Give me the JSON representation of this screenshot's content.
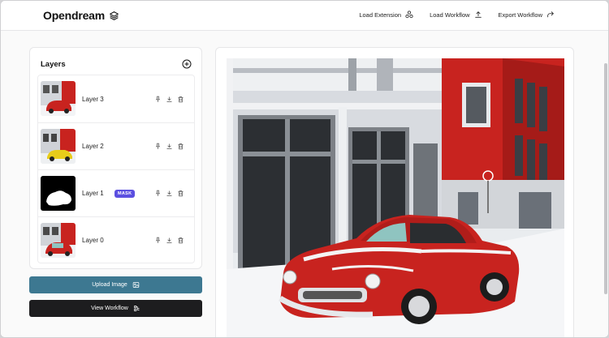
{
  "app": {
    "title": "Opendream"
  },
  "nav": {
    "load_extension": "Load Extension",
    "load_workflow": "Load Workflow",
    "export_workflow": "Export Workflow"
  },
  "layers": {
    "header": "Layers",
    "items": [
      {
        "name": "Layer 3",
        "badge": ""
      },
      {
        "name": "Layer 2",
        "badge": ""
      },
      {
        "name": "Layer 1",
        "badge": "MASK"
      },
      {
        "name": "Layer 0",
        "badge": ""
      }
    ]
  },
  "actions": {
    "upload_image": "Upload Image",
    "view_workflow": "View Workflow"
  },
  "colors": {
    "upload_button": "#3d7891",
    "view_button": "#1d1d1f",
    "mask_badge": "#5b4fe0",
    "car_red": "#c8231f"
  }
}
